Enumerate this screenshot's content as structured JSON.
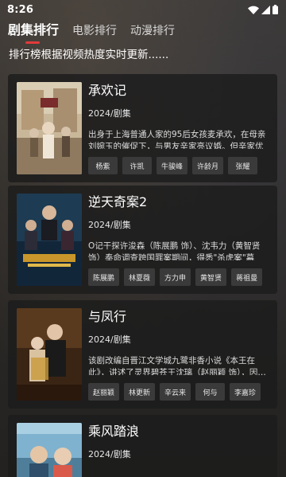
{
  "status": {
    "time": "8:26"
  },
  "tabs": [
    {
      "label": "剧集排行"
    },
    {
      "label": "电影排行"
    },
    {
      "label": "动漫排行"
    }
  ],
  "subtitle": "排行榜根据视频热度实时更新......",
  "items": [
    {
      "title": "承欢记",
      "meta": "2024/剧集",
      "desc": "出身于上海普通人家的95后女孩麦承欢，在母亲刘婉玉的催促下，与男友辛家亮议婚。但辛家优渥…",
      "actors": [
        "杨紫",
        "许凯",
        "牛骏峰",
        "许龄月",
        "张耀"
      ]
    },
    {
      "title": "逆天奇案2",
      "meta": "2024/剧集",
      "desc": "O记干探许浚森（陈展鹏 饰）、沈韦力（黄智贤 饰）奉命调查跨国罪案期间，得悉\"杀虎案\"幕后…",
      "actors": [
        "陈展鹏",
        "林夏薇",
        "方力申",
        "黄智贤",
        "蒋祖曼"
      ]
    },
    {
      "title": "与凤行",
      "meta": "2024/剧集",
      "desc": "该剧改编自晋江文学城九鹭非香小说《本王在此》，讲述了灵界碧苍王沈璃（赵丽颖 饰），因…",
      "actors": [
        "赵丽颖",
        "林更新",
        "辛云来",
        "何与",
        "李嘉珍"
      ]
    },
    {
      "title": "乘风踏浪",
      "meta": "2024/剧集",
      "desc": "",
      "actors": []
    }
  ]
}
